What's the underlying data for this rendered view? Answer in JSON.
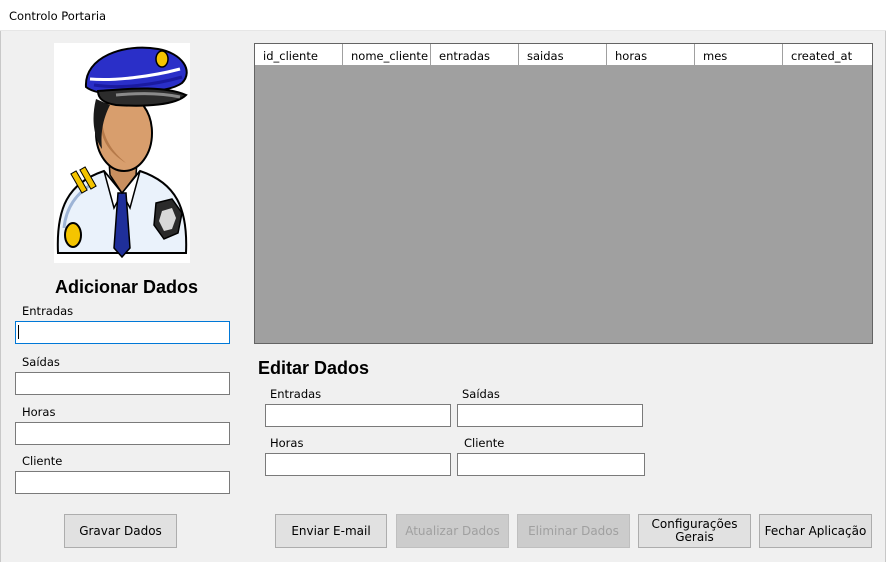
{
  "window": {
    "title": "Controlo Portaria"
  },
  "icons": {
    "avatar": "security-guard-icon"
  },
  "add_section": {
    "heading": "Adicionar Dados",
    "fields": [
      {
        "label": "Entradas",
        "value": ""
      },
      {
        "label": "Saídas",
        "value": ""
      },
      {
        "label": "Horas",
        "value": ""
      },
      {
        "label": "Cliente",
        "value": ""
      }
    ],
    "save_label": "Gravar Dados"
  },
  "grid": {
    "columns": [
      "id_cliente",
      "nome_cliente",
      "entradas",
      "saidas",
      "horas",
      "mes",
      "created_at"
    ],
    "rows": []
  },
  "edit_section": {
    "heading": "Editar Dados",
    "fields": [
      {
        "label": "Entradas",
        "value": ""
      },
      {
        "label": "Saídas",
        "value": ""
      },
      {
        "label": "Horas",
        "value": ""
      },
      {
        "label": "Cliente",
        "value": ""
      }
    ]
  },
  "buttons": {
    "send_email": "Enviar E-mail",
    "update": "Atualizar Dados",
    "delete": "Eliminar Dados",
    "settings": "Configurações\nGerais",
    "close": "Fechar Aplicação"
  },
  "colors": {
    "grid_background": "#a0a0a0",
    "focus_border": "#0078d7",
    "window_background": "#f0f0f0"
  }
}
